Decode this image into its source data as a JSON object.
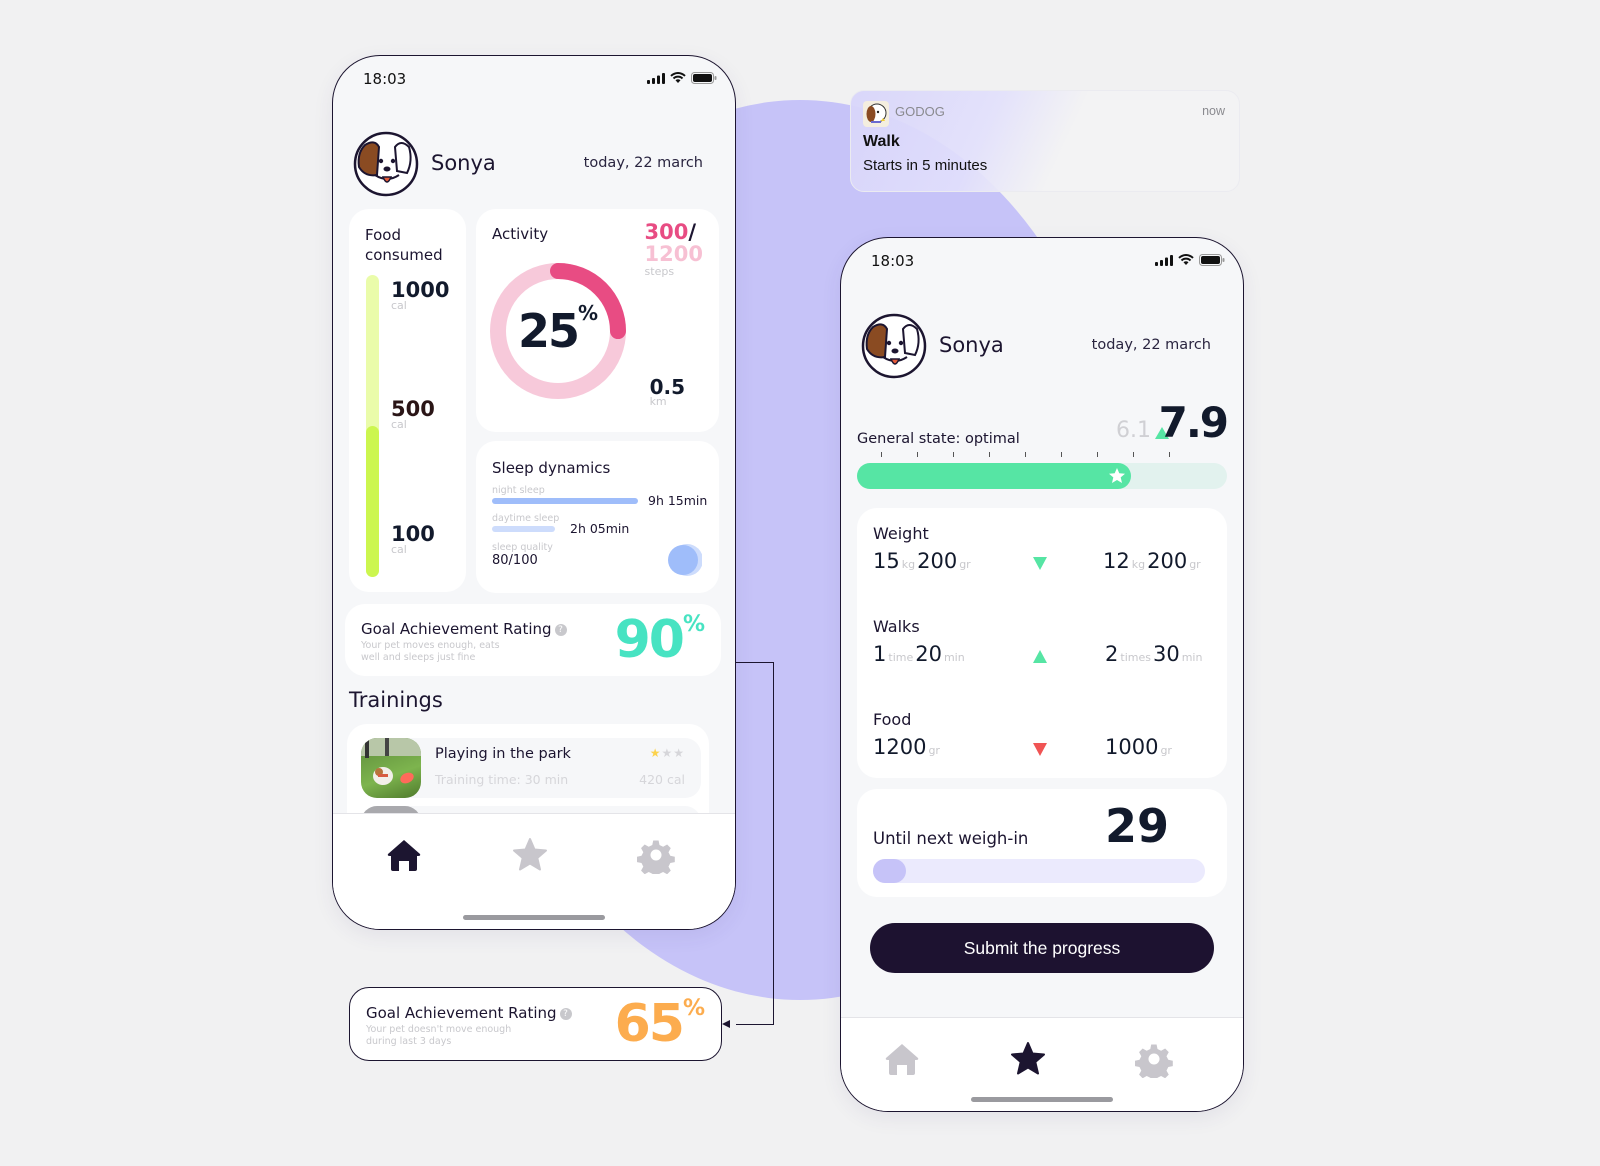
{
  "notification": {
    "app": "GODOG",
    "time": "now",
    "title": "Walk",
    "body": "Starts in 5 minutes",
    "icon": "dog-app-icon"
  },
  "phone_home": {
    "status": {
      "time": "18:03",
      "icons": [
        "signal-icon",
        "wifi-icon",
        "battery-icon"
      ]
    },
    "header": {
      "name": "Sonya",
      "date": "today, 22 march"
    },
    "food": {
      "title_line1": "Food",
      "title_line2": "consumed",
      "marks": [
        {
          "value": "1000",
          "unit": "cal"
        },
        {
          "value": "500",
          "unit": "cal"
        },
        {
          "value": "100",
          "unit": "cal"
        }
      ],
      "progress_fraction": 0.5,
      "colors": {
        "track": "#eafcaa",
        "fill": "#ccf64f"
      }
    },
    "activity": {
      "title": "Activity",
      "steps_current": "300",
      "steps_slash": "/",
      "steps_total": "1200",
      "steps_unit": "steps",
      "percent": "25",
      "percent_sign": "%",
      "progress_fraction": 0.25,
      "distance": "0.5",
      "distance_unit": "km",
      "colors": {
        "track": "#f7c9da",
        "fill": "#e84c83"
      }
    },
    "sleep": {
      "title": "Sleep dynamics",
      "night_label": "night sleep",
      "night_value": "9h 15min",
      "night_fraction": 1.0,
      "day_label": "daytime sleep",
      "day_value": "2h 05min",
      "day_fraction": 0.43,
      "quality_label": "sleep quality",
      "quality_value": "80/100",
      "colors": {
        "night": "#9fbdfa",
        "day": "#cddcfc"
      }
    },
    "goal": {
      "title": "Goal Achievement Rating",
      "desc": "Your pet moves enough, eats well and sleeps just fine",
      "percent": "90",
      "percent_sign": "%",
      "color": "#47e3c2"
    },
    "trainings": {
      "title": "Trainings",
      "items": [
        {
          "name": "Playing in the park",
          "time": "Training time: 30 min",
          "cal": "420 cal",
          "rating": 1,
          "rating_max": 3
        }
      ]
    },
    "tabs": [
      {
        "name": "home",
        "active": true
      },
      {
        "name": "favorites",
        "active": false
      },
      {
        "name": "settings",
        "active": false
      }
    ]
  },
  "goal_alt": {
    "title": "Goal Achievement Rating",
    "desc": "Your pet doesn't move enough during last 3 days",
    "percent": "65",
    "percent_sign": "%",
    "color": "#fcac4e"
  },
  "phone_progress": {
    "status": {
      "time": "18:03"
    },
    "header": {
      "name": "Sonya",
      "date": "today, 22 march"
    },
    "general_state": {
      "label": "General state: optimal",
      "previous": "6.1",
      "current": "7.9",
      "progress_fraction": 0.74,
      "tick_count": 9
    },
    "stats": [
      {
        "name": "Weight",
        "trend": "down",
        "trend_color": "#56e5a4",
        "before": [
          {
            "n": "15",
            "u": "kg"
          },
          {
            "n": "200",
            "u": "gr"
          }
        ],
        "after": [
          {
            "n": "12",
            "u": "kg"
          },
          {
            "n": "200",
            "u": "gr"
          }
        ]
      },
      {
        "name": "Walks",
        "trend": "up",
        "trend_color": "#56e5a4",
        "before": [
          {
            "n": "1",
            "u": "time"
          },
          {
            "n": "20",
            "u": "min"
          }
        ],
        "after": [
          {
            "n": "2",
            "u": "times"
          },
          {
            "n": "30",
            "u": "min"
          }
        ]
      },
      {
        "name": "Food",
        "trend": "down",
        "trend_color": "#f05454",
        "before": [
          {
            "n": "1200",
            "u": "gr"
          }
        ],
        "after": [
          {
            "n": "1000",
            "u": "gr"
          }
        ]
      }
    ],
    "weigh_in": {
      "label": "Until next weigh-in",
      "days": "29",
      "progress_fraction": 0.1
    },
    "submit_label": "Submit the progress",
    "tabs": [
      {
        "name": "home",
        "active": false
      },
      {
        "name": "favorites",
        "active": true
      },
      {
        "name": "settings",
        "active": false
      }
    ]
  }
}
